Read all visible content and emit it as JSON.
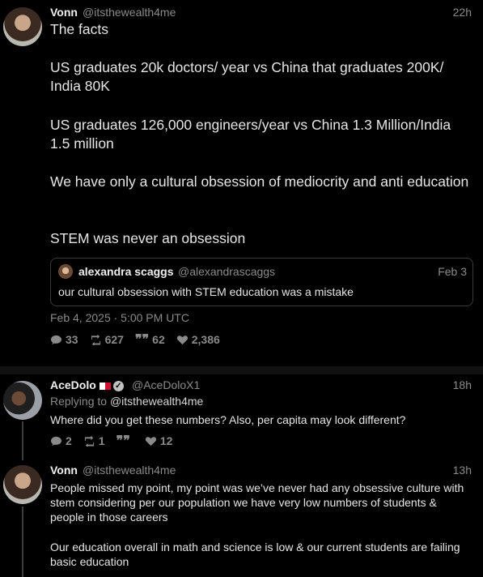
{
  "tweet1": {
    "name": "Vonn",
    "handle": "@itsthewealth4me",
    "time": "22h",
    "paragraphs": [
      "The facts",
      "US graduates 20k doctors/ year vs China that graduates 200K/ India 80K",
      "US graduates 126,000 engineers/year vs China 1.3 Million/India 1.5 million",
      "We have only a cultural obsession of mediocrity and anti education",
      "STEM was never an obsession"
    ],
    "quote": {
      "name": "alexandra scaggs",
      "handle": "@alexandrascaggs",
      "date": "Feb 3",
      "text": "our cultural obsession with STEM education was a mistake"
    },
    "timestamp": "Feb 4, 2025 · 5:00 PM UTC",
    "stats": {
      "replies": "33",
      "retweets": "627",
      "quotes": "62",
      "likes": "2,386"
    }
  },
  "reply1": {
    "name": "AceDolo",
    "handle": "@AceDoloX1",
    "time": "18h",
    "replying_prefix": "Replying to",
    "replying_to": "@itsthewealth4me",
    "text": "Where did you get these numbers? Also, per capita may look different?",
    "stats": {
      "replies": "2",
      "retweets": "1",
      "quotes": "",
      "likes": "12"
    }
  },
  "reply2": {
    "name": "Vonn",
    "handle": "@itsthewealth4me",
    "time": "13h",
    "paragraphs": [
      "People missed my point, my point was we’ve never had any obsessive culture with stem considering per our population we have very low numbers of students & people in those careers",
      "Our education overall in math and science is low & our current students are failing basic education"
    ]
  },
  "colors": {
    "background": "#000000",
    "muted": "#8a8a8a",
    "text": "#e6e6e6"
  }
}
